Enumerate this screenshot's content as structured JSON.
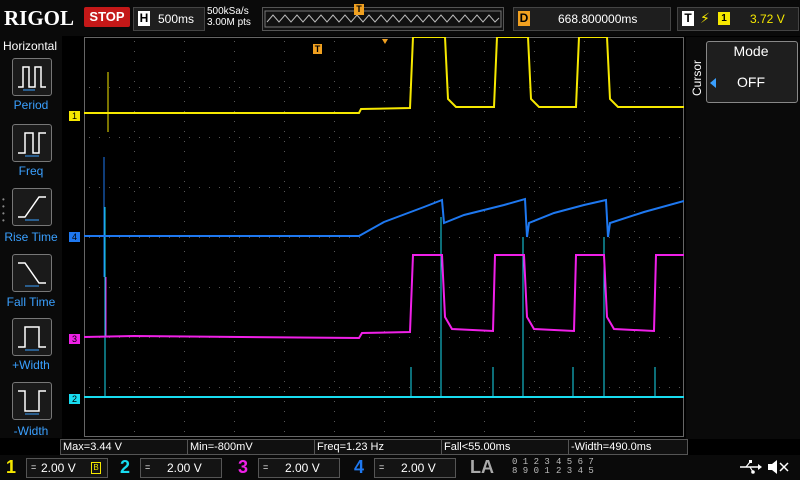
{
  "brand": "RIGOL",
  "run_state": "STOP",
  "timebase": {
    "label": "H",
    "value": "500ms"
  },
  "sample": {
    "rate": "500kSa/s",
    "points": "3.00M pts"
  },
  "trigger_marker": "T",
  "delay": {
    "label": "D",
    "value": "668.800000ms"
  },
  "trigger": {
    "label": "T",
    "edge_icon": "rising-edge-icon",
    "source": "1",
    "level": "3.72 V"
  },
  "left_panel": {
    "title": "Horizontal",
    "items": [
      {
        "label": "Period",
        "icon": "period-icon"
      },
      {
        "label": "Freq",
        "icon": "freq-icon"
      },
      {
        "label": "Rise Time",
        "icon": "rise-time-icon"
      },
      {
        "label": "Fall Time",
        "icon": "fall-time-icon"
      },
      {
        "label": "+Width",
        "icon": "pos-width-icon"
      },
      {
        "label": "-Width",
        "icon": "neg-width-icon"
      }
    ]
  },
  "right_panel": {
    "side_label": "Cursor",
    "mode_title": "Mode",
    "mode_value": "OFF"
  },
  "measurements": [
    {
      "text": "Max=3.44 V"
    },
    {
      "text": "Min=-800mV"
    },
    {
      "text": "Freq=1.23 Hz"
    },
    {
      "text": "Fall<55.00ms"
    },
    {
      "text": "-Width=490.0ms"
    }
  ],
  "channels": [
    {
      "num": "1",
      "coupling": "=",
      "scale": "2.00 V",
      "color": "#f6e800"
    },
    {
      "num": "2",
      "coupling": "=",
      "scale": "2.00 V",
      "color": "#18dcf0"
    },
    {
      "num": "3",
      "coupling": "=",
      "scale": "2.00 V",
      "color": "#f020e8"
    },
    {
      "num": "4",
      "coupling": "=",
      "scale": "2.00 V",
      "color": "#1e78f0"
    }
  ],
  "channel_markers": [
    "1",
    "4",
    "3",
    "2"
  ],
  "la": {
    "label": "LA",
    "groups": [
      "0 1 2 3",
      "4 5 6 7",
      "8 9 0 1",
      "2 3 4 5"
    ]
  },
  "colors": {
    "ch1": "#f6e800",
    "ch2": "#18dcf0",
    "ch3": "#f020e8",
    "ch4": "#1e78f0",
    "stop": "#c41818",
    "accent": "#3aa0ff",
    "delay": "#f0a020"
  },
  "status_icons": [
    "usb-icon",
    "speaker-muted-icon"
  ]
}
